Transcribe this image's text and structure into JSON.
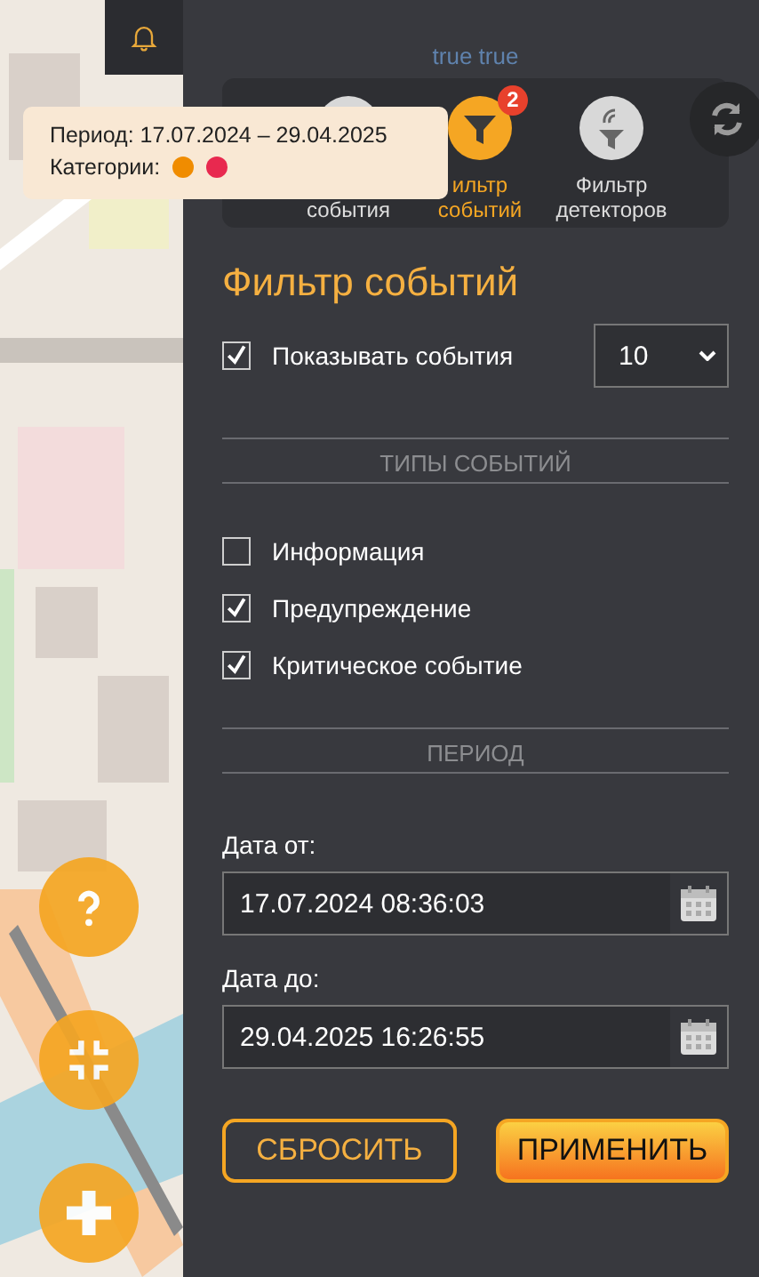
{
  "caption": "true true",
  "tabs": [
    {
      "label": "события",
      "selected": false
    },
    {
      "label": "ильтр событий",
      "selected": true,
      "badge": "2"
    },
    {
      "label": "Фильтр детекторов",
      "selected": false
    }
  ],
  "tooltip": {
    "period": "Период: 17.07.2024 – 29.04.2025",
    "categories_label": "Категории:",
    "categories": [
      {
        "color": "#f08c00"
      },
      {
        "color": "#e8294f"
      }
    ]
  },
  "title": "Фильтр событий",
  "show_events": {
    "label": "Показывать события",
    "checked": true,
    "count": "10"
  },
  "types_heading": "ТИПЫ СОБЫТИЙ",
  "types": [
    {
      "label": "Информация",
      "checked": false
    },
    {
      "label": "Предупреждение",
      "checked": true
    },
    {
      "label": "Критическое событие",
      "checked": true
    }
  ],
  "period_heading": "ПЕРИОД",
  "dates": [
    {
      "label": "Дата от:",
      "value": "17.07.2024 08:36:03"
    },
    {
      "label": "Дата до:",
      "value": "29.04.2025 16:26:55"
    }
  ],
  "buttons": [
    {
      "kind": "outline",
      "label": "СБРОСИТЬ"
    },
    {
      "kind": "primary",
      "label": "ПРИМЕНИТЬ"
    }
  ]
}
